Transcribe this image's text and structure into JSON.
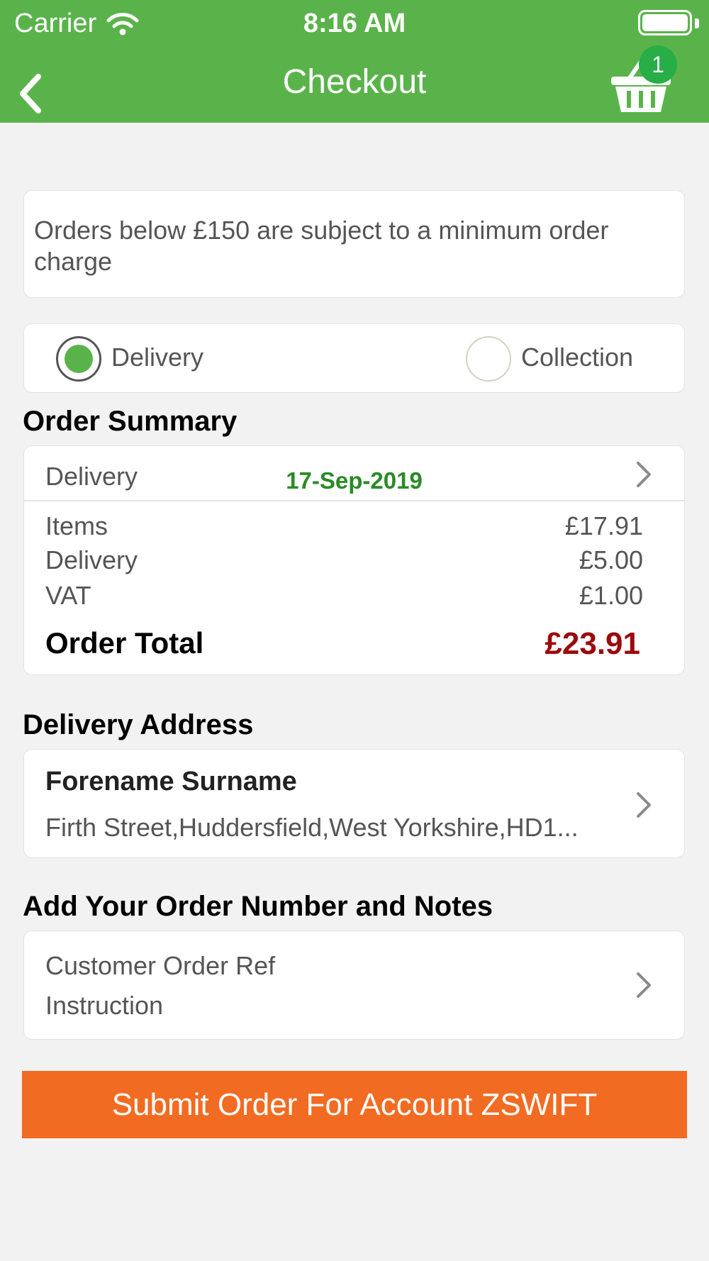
{
  "status_bar": {
    "carrier": "Carrier",
    "time": "8:16 AM"
  },
  "nav": {
    "title": "Checkout",
    "cart_count": "1"
  },
  "notice": {
    "text": "Orders below £150 are subject to a minimum order charge"
  },
  "fulfilment": {
    "options": [
      {
        "label": "Delivery",
        "selected": true
      },
      {
        "label": "Collection",
        "selected": false
      }
    ]
  },
  "order_summary": {
    "heading": "Order Summary",
    "method_label": "Delivery",
    "date": "17-Sep-2019",
    "lines": [
      {
        "label": "Items",
        "value": "£17.91"
      },
      {
        "label": "Delivery",
        "value": "£5.00"
      },
      {
        "label": "VAT",
        "value": "£1.00"
      }
    ],
    "total_label": "Order Total",
    "total_value": "£23.91"
  },
  "delivery_address": {
    "heading": "Delivery Address",
    "name": "Forename Surname",
    "address": "Firth Street,Huddersfield,West Yorkshire,HD1..."
  },
  "notes": {
    "heading": "Add Your Order Number and Notes",
    "ref_label": "Customer Order Ref",
    "instruction_label": "Instruction"
  },
  "submit": {
    "label": "Submit Order For Account ZSWIFT"
  },
  "colors": {
    "header": "#5ab34a",
    "badge": "#27ae47",
    "date": "#2a8a25",
    "total": "#9b0a0a",
    "submit": "#f26b22"
  }
}
